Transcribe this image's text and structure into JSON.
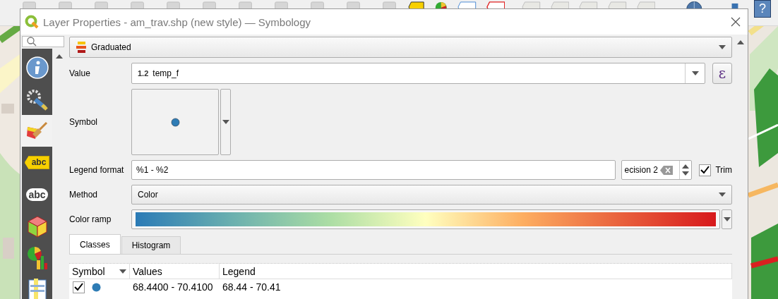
{
  "window": {
    "title": "Layer Properties - am_trav.shp (new style) — Symbology"
  },
  "help_button": "?",
  "sidebar": {
    "items": [
      {
        "kind": "info",
        "selected": false
      },
      {
        "kind": "tools",
        "selected": false
      },
      {
        "kind": "brush",
        "selected": true
      },
      {
        "kind": "tag",
        "text": "abc",
        "selected": false
      },
      {
        "kind": "bubble",
        "text": "abc",
        "selected": false
      },
      {
        "kind": "cube",
        "selected": false
      },
      {
        "kind": "chart",
        "selected": false
      },
      {
        "kind": "form",
        "selected": false
      }
    ]
  },
  "renderer": {
    "label": "Graduated"
  },
  "value": {
    "label": "Value",
    "type_badge": "1.2",
    "field": "temp_f",
    "expression_button": "ε"
  },
  "symbol": {
    "label": "Symbol"
  },
  "legend_format": {
    "label": "Legend format",
    "value": "%1 - %2",
    "precision": "ecision 2",
    "trim": {
      "label": "Trim",
      "checked": true
    }
  },
  "method": {
    "label": "Method",
    "value": "Color"
  },
  "color_ramp": {
    "label": "Color ramp"
  },
  "tabs": [
    {
      "label": "Classes",
      "selected": true
    },
    {
      "label": "Histogram",
      "selected": false
    }
  ],
  "table": {
    "columns": [
      "Symbol",
      "Values",
      "Legend"
    ],
    "rows": [
      {
        "checked": true,
        "color": "#2e7cb5",
        "values": "68.4400 - 70.4100",
        "legend": "68.44 - 70.41"
      }
    ]
  }
}
